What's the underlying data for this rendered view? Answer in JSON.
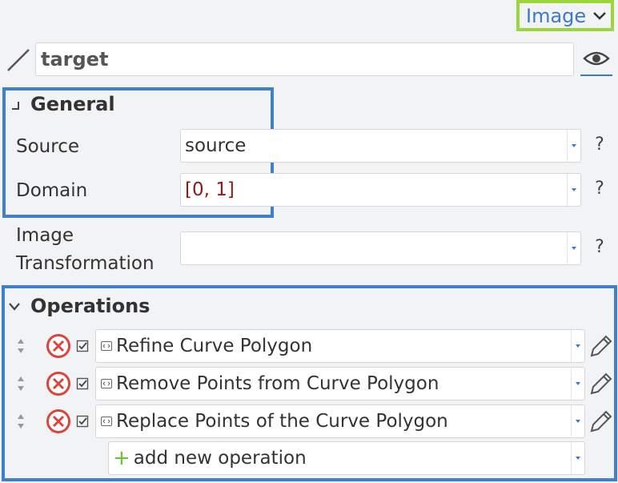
{
  "header": {
    "type_selector_label": "Image",
    "name_value": "target"
  },
  "general": {
    "title": "General",
    "properties": [
      {
        "label": "Source",
        "value": "source",
        "help": "?"
      },
      {
        "label": "Domain",
        "value": "[0, 1]",
        "help": "?"
      },
      {
        "label_line1": "Image",
        "label_line2": "Transformation",
        "value": "",
        "help": "?"
      }
    ]
  },
  "operations": {
    "title": "Operations",
    "items": [
      {
        "label": "Refine Curve Polygon"
      },
      {
        "label": "Remove Points from Curve Polygon"
      },
      {
        "label": "Replace Points of the Curve Polygon"
      }
    ],
    "add_label": "add new operation"
  },
  "colors": {
    "accent": "#3c78c8",
    "section_border": "#3f7fcc",
    "type_selector_border": "#9bd63a",
    "remove": "#d9453c",
    "add": "#6cbf2f",
    "domain_value": "#8b1a1a"
  },
  "icons": [
    "chevron-down-icon",
    "pen-icon",
    "eye-icon",
    "collapse-icon",
    "sort-handle-icon",
    "remove-icon",
    "checkbox-icon",
    "operation-icon",
    "edit-pencil-icon",
    "plus-icon"
  ]
}
